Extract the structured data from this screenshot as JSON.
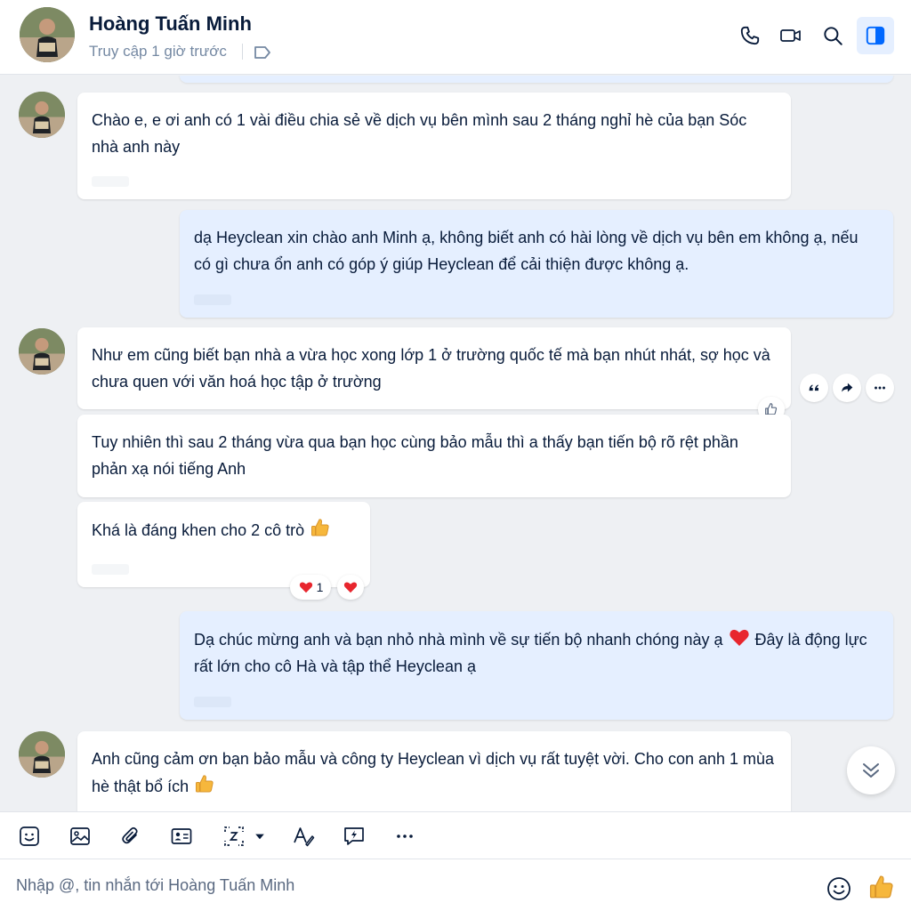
{
  "header": {
    "name": "Hoàng Tuấn Minh",
    "status": "Truy cập 1 giờ trước",
    "icons": [
      "phone-icon",
      "video-call-icon",
      "search-icon",
      "sidebar-toggle-icon",
      "tag-icon"
    ]
  },
  "messages": [
    {
      "from": "them",
      "text": "Chào e, e ơi anh có 1 vài điều chia sẻ về dịch vụ bên mình sau 2 tháng nghỉ hè của bạn Sóc nhà anh này"
    },
    {
      "from": "me",
      "text": "dạ Heyclean xin chào anh Minh ạ, không biết anh có hài lòng về dịch vụ bên em không ạ, nếu có gì chưa ổn anh có góp ý giúp Heyclean để cải thiện được không ạ."
    },
    {
      "from": "them",
      "text": "Như em cũng biết bạn nhà a vừa học xong lớp 1 ở trường quốc tế mà bạn nhút nhát, sợ học và chưa quen với văn hoá học tập ở trường"
    },
    {
      "from": "them",
      "text": "Tuy nhiên thì sau 2 tháng vừa qua bạn học cùng bảo mẫu thì a thấy bạn tiến bộ rõ rệt phần phản xạ nói tiếng Anh"
    },
    {
      "from": "them",
      "text": "Khá là đáng khen cho 2 cô trò",
      "emoji": "thumbs-up",
      "reaction_count": "1"
    },
    {
      "from": "me",
      "text_before": "Dạ chúc mừng anh và bạn nhỏ nhà mình về sự tiến bộ nhanh chóng này ạ",
      "emoji": "heart",
      "text_after": "Đây là động lực rất lớn cho cô Hà và tập thể Heyclean ạ"
    },
    {
      "from": "them",
      "text": "Anh cũng cảm ơn bạn bảo mẫu và công ty Heyclean vì dịch vụ rất tuyệt vời. Cho con anh 1 mùa hè thật bổ ích",
      "emoji": "thumbs-up"
    }
  ],
  "toolbar": {
    "icons": [
      "sticker-icon",
      "image-icon",
      "attachment-icon",
      "contact-card-icon",
      "screenshot-icon",
      "text-format-icon",
      "quick-message-icon",
      "more-icon"
    ]
  },
  "composer": {
    "placeholder": "Nhập @, tin nhắn tới Hoàng Tuấn Minh"
  },
  "colors": {
    "my_bubble": "#e5efff",
    "their_bubble": "#ffffff",
    "background": "#eef0f3",
    "accent": "#0068ff",
    "heart": "#e8262e",
    "thumb": "#f6b73c"
  }
}
